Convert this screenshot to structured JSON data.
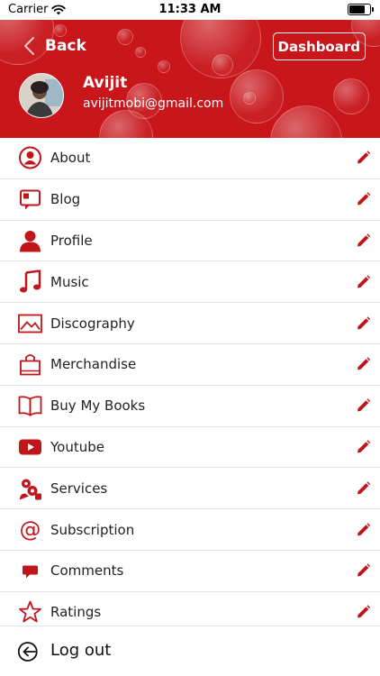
{
  "status_bar": {
    "carrier": "Carrier",
    "time": "11:33 AM"
  },
  "header": {
    "back_label": "Back",
    "dashboard_label": "Dashboard",
    "user_name": "Avijit",
    "user_email": "avijitmobi@gmail.com"
  },
  "colors": {
    "brand_red": "#c8161b",
    "icon_red": "#c0161b",
    "divider": "#e4e4e4"
  },
  "menu": {
    "items": [
      {
        "label": "About",
        "icon": "about-person-icon"
      },
      {
        "label": "Blog",
        "icon": "blog-icon"
      },
      {
        "label": "Profile",
        "icon": "profile-icon"
      },
      {
        "label": "Music",
        "icon": "music-note-icon"
      },
      {
        "label": "Discography",
        "icon": "image-icon"
      },
      {
        "label": "Merchandise",
        "icon": "shopping-bag-icon"
      },
      {
        "label": "Buy My Books",
        "icon": "book-icon"
      },
      {
        "label": "Youtube",
        "icon": "youtube-icon"
      },
      {
        "label": "Services",
        "icon": "services-gears-icon"
      },
      {
        "label": "Subscription",
        "icon": "at-sign-icon"
      },
      {
        "label": "Comments",
        "icon": "comment-icon"
      },
      {
        "label": "Ratings",
        "icon": "star-icon"
      }
    ]
  },
  "logout": {
    "label": "Log out",
    "icon": "logout-icon"
  }
}
